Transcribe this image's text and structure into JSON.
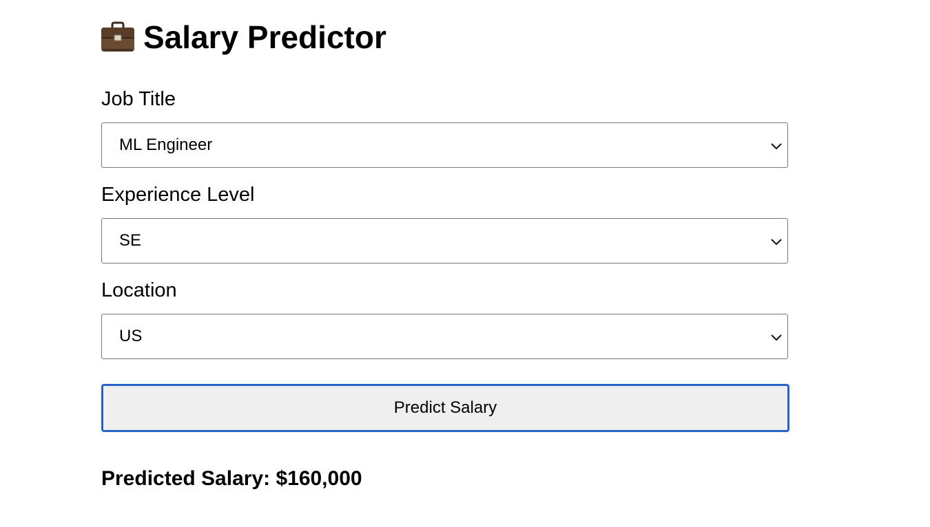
{
  "app": {
    "title": "Salary Predictor",
    "title_icon": "briefcase-icon"
  },
  "form": {
    "job_title": {
      "label": "Job Title",
      "selected": "ML Engineer"
    },
    "experience_level": {
      "label": "Experience Level",
      "selected": "SE"
    },
    "location": {
      "label": "Location",
      "selected": "US"
    },
    "submit_label": "Predict Salary"
  },
  "result": {
    "text": "Predicted Salary: $160,000"
  },
  "colors": {
    "button_border": "#2563c5",
    "button_background": "#efefef",
    "select_border": "#767676"
  }
}
